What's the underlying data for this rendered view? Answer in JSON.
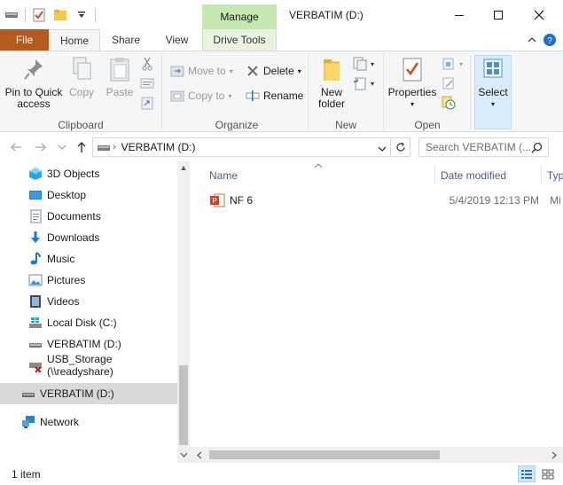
{
  "window": {
    "title": "VERBATIM (D:)",
    "context_tab": "Manage",
    "controls": {
      "minimize": "–",
      "maximize": "☐",
      "close": "✕"
    }
  },
  "ribbon_tabs": {
    "file": "File",
    "home": "Home",
    "share": "Share",
    "view": "View",
    "drive_tools": "Drive Tools"
  },
  "ribbon": {
    "clipboard": {
      "label": "Clipboard",
      "pin_line1": "Pin to Quick",
      "pin_line2": "access",
      "copy": "Copy",
      "paste": "Paste"
    },
    "organize": {
      "label": "Organize",
      "move_to": "Move to",
      "copy_to": "Copy to",
      "delete": "Delete",
      "rename": "Rename"
    },
    "new": {
      "label": "New",
      "new_folder_line1": "New",
      "new_folder_line2": "folder"
    },
    "open": {
      "label": "Open",
      "properties": "Properties"
    },
    "select": {
      "label": "Select"
    }
  },
  "address": {
    "path": "VERBATIM (D:)",
    "search_placeholder": "Search VERBATIM (..."
  },
  "nav_pane": {
    "items": [
      {
        "label": "3D Objects"
      },
      {
        "label": "Desktop"
      },
      {
        "label": "Documents"
      },
      {
        "label": "Downloads"
      },
      {
        "label": "Music"
      },
      {
        "label": "Pictures"
      },
      {
        "label": "Videos"
      },
      {
        "label": "Local Disk (C:)"
      },
      {
        "label": "VERBATIM (D:)"
      },
      {
        "label": "USB_Storage (\\\\readyshare)"
      },
      {
        "label": "VERBATIM (D:)"
      },
      {
        "label": "Network"
      }
    ]
  },
  "file_list": {
    "columns": {
      "name": "Name",
      "date_modified": "Date modified",
      "type": "Typ"
    },
    "rows": [
      {
        "name": "NF 6",
        "date_modified": "5/4/2019 12:13 PM",
        "type": "Mi"
      }
    ]
  },
  "status": {
    "item_count": "1 item"
  },
  "colors": {
    "file_tab": "#b35b1e",
    "manage_tab": "#c5e9b0",
    "select_highlight": "#d9ecfb",
    "nav_selected": "#d9d9d9"
  }
}
